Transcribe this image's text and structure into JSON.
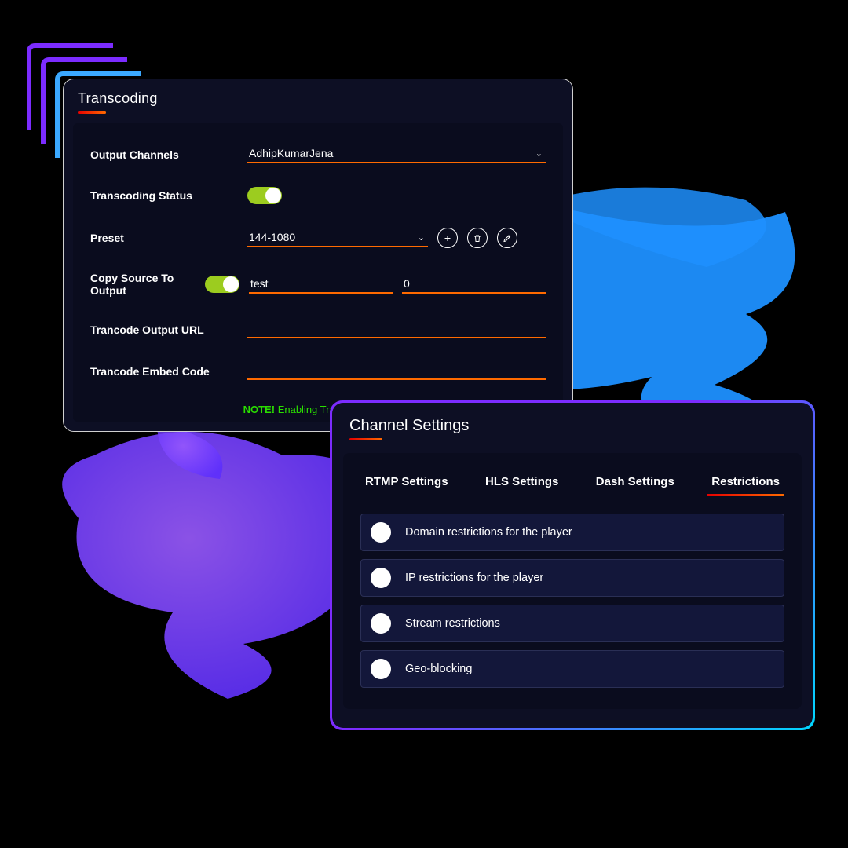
{
  "transcoding": {
    "title": "Transcoding",
    "labels": {
      "output_channels": "Output Channels",
      "transcoding_status": "Transcoding Status",
      "preset": "Preset",
      "copy_source": "Copy Source To Output",
      "output_url": "Trancode Output URL",
      "embed_code": "Trancode Embed Code"
    },
    "values": {
      "output_channel": "AdhipKumarJena",
      "transcoding_status_on": true,
      "preset": "144-1080",
      "copy_source_on": true,
      "copy_text": "test",
      "copy_number": "0",
      "output_url": "",
      "embed_code": ""
    },
    "icons": {
      "add": "plus-icon",
      "delete": "trash-icon",
      "edit": "pencil-icon"
    },
    "note": {
      "bold": "NOTE!",
      "text": "Enabling Transcoding will "
    }
  },
  "channel_settings": {
    "title": "Channel Settings",
    "tabs": [
      {
        "label": "RTMP Settings",
        "active": false
      },
      {
        "label": "HLS Settings",
        "active": false
      },
      {
        "label": "Dash Settings",
        "active": false
      },
      {
        "label": "Restrictions",
        "active": true
      }
    ],
    "options": [
      {
        "label": "Domain restrictions for the player"
      },
      {
        "label": "IP restrictions for the player"
      },
      {
        "label": "Stream restrictions"
      },
      {
        "label": "Geo-blocking"
      }
    ]
  }
}
